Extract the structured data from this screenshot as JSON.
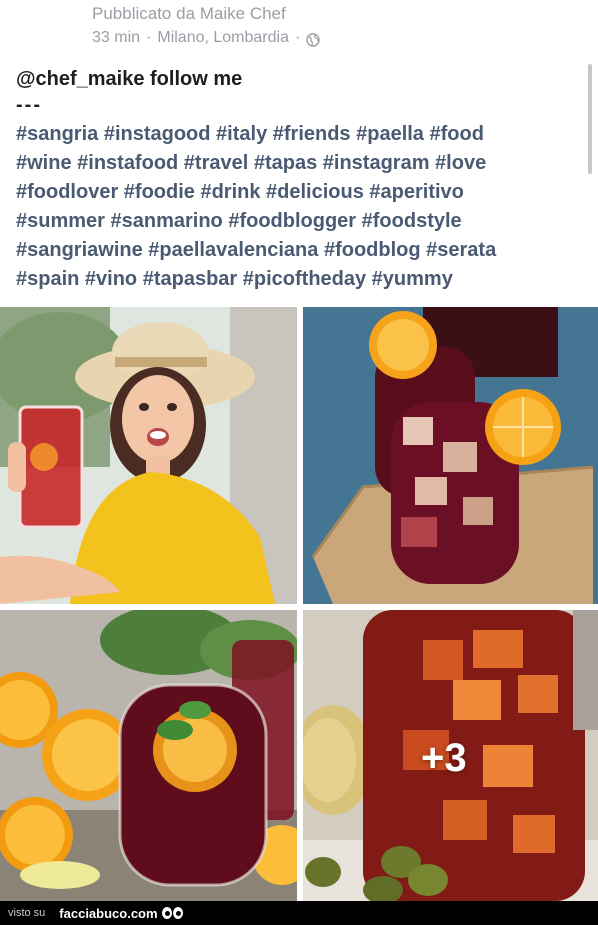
{
  "post": {
    "posted_by": "Pubblicato da Maike Chef",
    "time": "33 min",
    "location": "Milano, Lombardia",
    "separator": "·",
    "privacy_icon": "globe-icon",
    "mention_line": "@chef_maike follow me",
    "dash_line": "---",
    "hashtag_lines": [
      "#sangria #instagood #italy #friends #paella #food",
      "#wine #instafood #travel #tapas #instagram #love",
      "#foodlover #foodie #drink #delicious #aperitivo",
      "#summer #sanmarino #foodblogger #foodstyle",
      "#sangriawine #paellavalenciana #foodblog #serata",
      "#spain #vino #tapasbar #picoftheday #yummy"
    ]
  },
  "photos": {
    "more_count": "+3"
  },
  "footer": {
    "visto_su": "visto su",
    "site": "facciabuco.com"
  }
}
